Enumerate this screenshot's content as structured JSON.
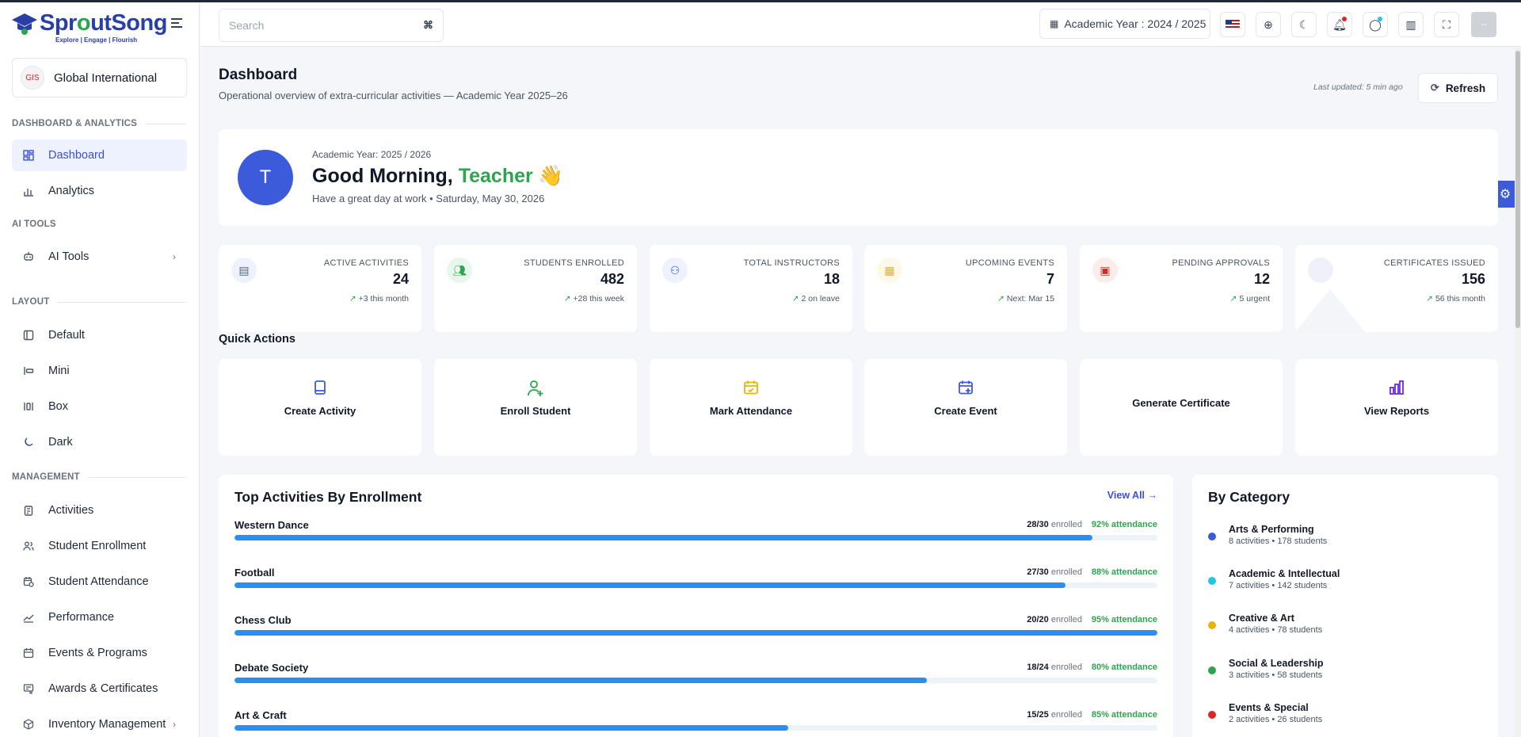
{
  "brand": {
    "name_pre": "Spr",
    "name_o": "o",
    "name_post": "utSong",
    "tagline": "Explore | Engage | Flourish"
  },
  "school": {
    "name": "Global International",
    "logo_text": "GIS"
  },
  "sidebar": {
    "sections": {
      "dashboard": "DASHBOARD & ANALYTICS",
      "ai": "AI TOOLS",
      "layout": "LAYOUT",
      "management": "MANAGEMENT"
    },
    "items": {
      "dashboard": "Dashboard",
      "analytics": "Analytics",
      "ai_tools": "AI Tools",
      "default": "Default",
      "mini": "Mini",
      "box": "Box",
      "dark": "Dark",
      "activities": "Activities",
      "student_enrollment": "Student Enrollment",
      "student_attendance": "Student Attendance",
      "performance": "Performance",
      "events_programs": "Events & Programs",
      "awards_certificates": "Awards & Certificates",
      "inventory_management": "Inventory Management"
    }
  },
  "header": {
    "search_placeholder": "Search",
    "search_shortcut": "⌘",
    "academic_year": "Academic Year : 2024 / 2025",
    "avatar_text": "--"
  },
  "page": {
    "title": "Dashboard",
    "subtitle": "Operational overview of extra-curricular activities — Academic Year 2025–26",
    "last_updated": "Last updated: 5 min ago",
    "refresh": "Refresh"
  },
  "welcome": {
    "avatar": "T",
    "year": "Academic Year: 2025 / 2026",
    "greeting": "Good Morning, ",
    "role": "Teacher",
    "wave": "👋",
    "sub": "Have a great day at work • Saturday, May 30, 2026"
  },
  "stats": [
    {
      "label": "ACTIVE ACTIVITIES",
      "value": "24",
      "trend": "+3 this month",
      "color": "#3b5bdb",
      "bg": "#eef2ff",
      "icon": "book-icon"
    },
    {
      "label": "STUDENTS ENROLLED",
      "value": "482",
      "trend": "+28 this week",
      "color": "#2da44e",
      "bg": "#e8f7ee",
      "icon": "users-icon"
    },
    {
      "label": "TOTAL INSTRUCTORS",
      "value": "18",
      "trend": "2 on leave",
      "color": "#3b5bdb",
      "bg": "#eef2ff",
      "icon": "user-check-icon"
    },
    {
      "label": "UPCOMING EVENTS",
      "value": "7",
      "trend": "Next: Mar 15",
      "color": "#eab308",
      "bg": "#fef9e7",
      "icon": "calendar-icon"
    },
    {
      "label": "PENDING APPROVALS",
      "value": "12",
      "trend": "5 urgent",
      "color": "#dc2626",
      "bg": "#fdecec",
      "icon": "clipboard-icon"
    },
    {
      "label": "CERTIFICATES ISSUED",
      "value": "156",
      "trend": "56 this month",
      "color": "#8b5cf6",
      "bg": "#f0f0fa",
      "icon": "certificate-icon"
    }
  ],
  "quick_actions": {
    "title": "Quick Actions",
    "items": [
      {
        "label": "Create Activity",
        "color": "#3b5bdb",
        "icon": "book-icon"
      },
      {
        "label": "Enroll Student",
        "color": "#2da44e",
        "icon": "user-plus-icon"
      },
      {
        "label": "Mark Attendance",
        "color": "#eab308",
        "icon": "calendar-check-icon"
      },
      {
        "label": "Create Event",
        "color": "#3b5bdb",
        "icon": "calendar-plus-icon"
      },
      {
        "label": "Generate Certificate",
        "color": "#111827",
        "icon": ""
      },
      {
        "label": "View Reports",
        "color": "#6d28d9",
        "icon": "bar-chart-icon"
      }
    ]
  },
  "top_activities": {
    "title": "Top Activities By Enrollment",
    "view_all": "View All →",
    "enrolled_word": "enrolled",
    "rows": [
      {
        "name": "Western Dance",
        "count": "28/30",
        "attendance": "92% attendance",
        "fill": 0.93
      },
      {
        "name": "Football",
        "count": "27/30",
        "attendance": "88% attendance",
        "fill": 0.9
      },
      {
        "name": "Chess Club",
        "count": "20/20",
        "attendance": "95% attendance",
        "fill": 1.0
      },
      {
        "name": "Debate Society",
        "count": "18/24",
        "attendance": "80% attendance",
        "fill": 0.75
      },
      {
        "name": "Art & Craft",
        "count": "15/25",
        "attendance": "85% attendance",
        "fill": 0.6
      }
    ]
  },
  "by_category": {
    "title": "By Category",
    "items": [
      {
        "name": "Arts & Performing",
        "meta": "8 activities • 178 students",
        "color": "#3b5bdb"
      },
      {
        "name": "Academic & Intellectual",
        "meta": "7 activities • 142 students",
        "color": "#22c5e5"
      },
      {
        "name": "Creative & Art",
        "meta": "4 activities • 78 students",
        "color": "#eab308"
      },
      {
        "name": "Social & Leadership",
        "meta": "3 activities • 58 students",
        "color": "#2da44e"
      },
      {
        "name": "Events & Special",
        "meta": "2 activities • 26 students",
        "color": "#dc2626"
      }
    ]
  }
}
